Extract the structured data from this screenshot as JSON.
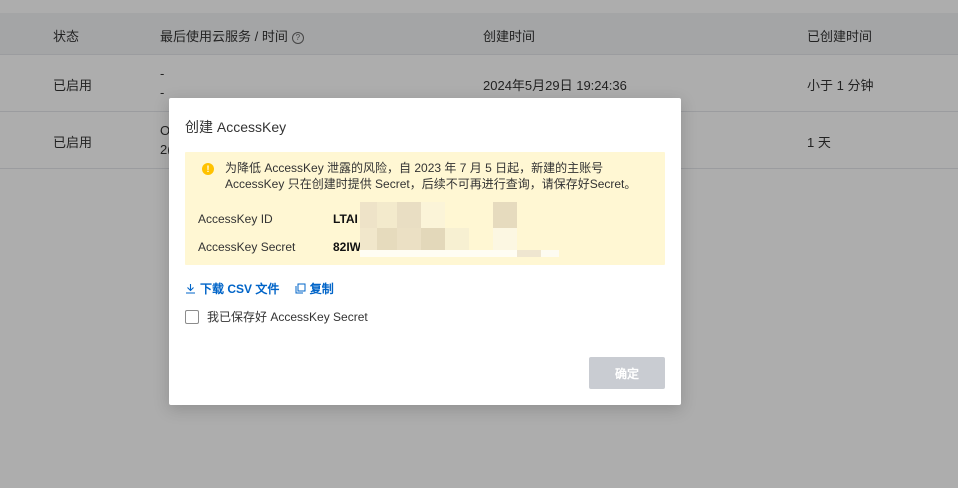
{
  "table": {
    "headers": [
      "状态",
      "最后使用云服务 / 时间",
      "创建时间",
      "已创建时间"
    ],
    "rows": [
      {
        "status": "已启用",
        "last_used_line1": "-",
        "last_used_line2": "-",
        "created": "2024年5月29日 19:24:36",
        "age": "小于 1 分钟"
      },
      {
        "status": "已启用",
        "last_used_line1": "O",
        "last_used_line2": "2(",
        "created": "",
        "age": "1 天"
      }
    ]
  },
  "modal": {
    "title": "创建 AccessKey",
    "notice": "为降低 AccessKey 泄露的风险，自 2023 年 7 月 5 日起，新建的主账号 AccessKey 只在创建时提供 Secret，后续不可再进行查询，请保存好Secret。",
    "id_label": "AccessKey ID",
    "id_value": "LTAI",
    "secret_label": "AccessKey Secret",
    "secret_value": "82IW",
    "download_label": "下载 CSV 文件",
    "copy_label": "复制",
    "checkbox_label": "我已保存好 AccessKey Secret",
    "confirm_label": "确定"
  },
  "colors": {
    "accent": "#0064c8",
    "notice_bg": "#fff7d3",
    "warn": "#ffc200",
    "disabled_btn": "#c9ccd2"
  },
  "icons": {
    "help": "help-circle-icon",
    "warn": "warning-icon",
    "download": "download-icon",
    "copy": "copy-icon"
  }
}
